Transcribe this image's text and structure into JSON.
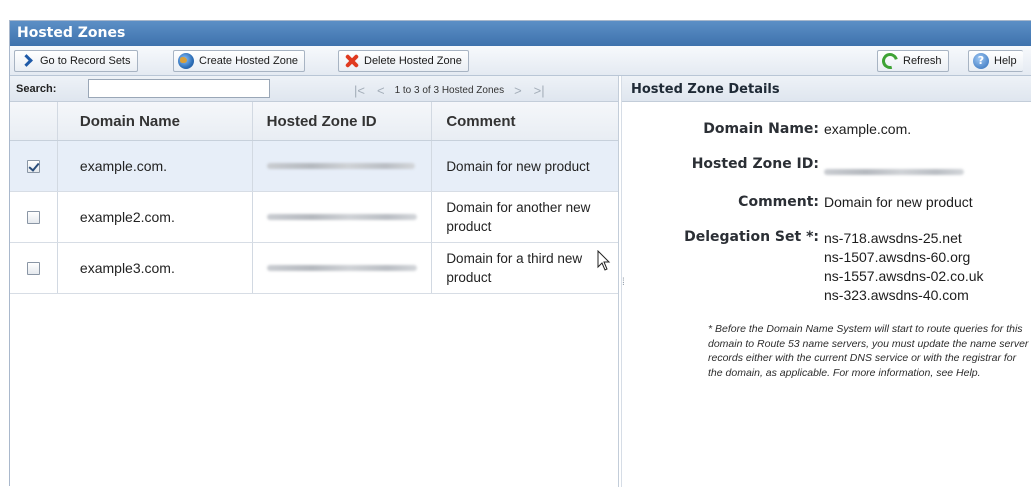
{
  "window": {
    "title": "Hosted Zones"
  },
  "toolbar": {
    "go_to_record_sets": "Go to Record Sets",
    "create_hosted_zone": "Create Hosted Zone",
    "delete_hosted_zone": "Delete Hosted Zone",
    "refresh": "Refresh",
    "help": "Help",
    "help_glyph": "?"
  },
  "search": {
    "label": "Search:",
    "value": "",
    "placeholder": ""
  },
  "pager": {
    "first": "|<",
    "prev": "<",
    "text": "1 to 3 of 3 Hosted Zones",
    "next": ">",
    "last": ">|"
  },
  "table": {
    "columns": [
      "Domain Name",
      "Hosted Zone ID",
      "Comment"
    ],
    "rows": [
      {
        "checked": true,
        "domain": "example.com.",
        "comment": "Domain for new product"
      },
      {
        "checked": false,
        "domain": "example2.com.",
        "comment": "Domain for another new product"
      },
      {
        "checked": false,
        "domain": "example3.com.",
        "comment": "Domain for a third new product"
      }
    ]
  },
  "details": {
    "header": "Hosted Zone Details",
    "domain_name_label": "Domain Name:",
    "domain_name_value": "example.com.",
    "zone_id_label": "Hosted Zone ID:",
    "comment_label": "Comment:",
    "comment_value": "Domain for new product",
    "delegation_label": "Delegation Set *:",
    "delegation_set": [
      "ns-718.awsdns-25.net",
      "ns-1507.awsdns-60.org",
      "ns-1557.awsdns-02.co.uk",
      "ns-323.awsdns-40.com"
    ],
    "note": "* Before the Domain Name System will start to route queries for this domain to Route 53 name servers, you must update the name server records either with the current DNS service or with the registrar for the domain, as applicable. For more information, see Help."
  },
  "icons": {
    "go_to_record_sets": "chevron-right-icon",
    "create_hosted_zone": "globe-icon",
    "delete_hosted_zone": "red-x-icon",
    "refresh": "refresh-icon",
    "help": "help-icon"
  },
  "colors": {
    "titlebar": "#4a7fba",
    "selected_row": "#e7eef8",
    "delete_icon": "#e03a1f",
    "refresh_icon": "#3ea335"
  }
}
